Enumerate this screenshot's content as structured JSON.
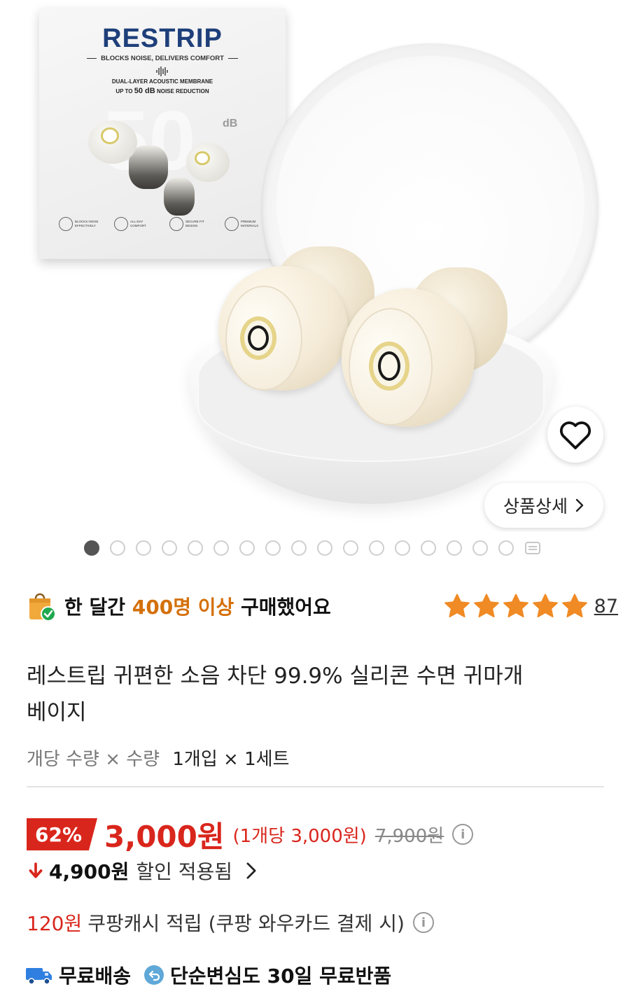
{
  "product_image": {
    "box_brand": "RESTRIP",
    "box_tagline": "BLOCKS NOISE, DELIVERS COMFORT",
    "box_spec_line1": "DUAL-LAYER ACOUSTIC MEMBRANE",
    "box_spec_line2_prefix": "UP TO",
    "box_spec_line2_value": "50 dB",
    "box_spec_line2_suffix": "NOISE REDUCTION",
    "box_big_number": "50",
    "box_db_label": "dB",
    "box_features": [
      {
        "label": "BLOCKS NOISE EFFECTIVELY",
        "icon": "sound-wave-icon"
      },
      {
        "label": "ALL-DAY COMFORT",
        "icon": "leaf-icon"
      },
      {
        "label": "SECURE FIT DESIGN",
        "icon": "ear-icon"
      },
      {
        "label": "PREMIUM MATERIALS",
        "icon": "shield-icon"
      }
    ],
    "wishlist_icon": "heart-icon",
    "detail_button_label": "상품상세",
    "carousel": {
      "total_dots": 17,
      "active_index": 0,
      "more_icon": "menu-lines-icon"
    }
  },
  "purchase_info": {
    "prefix": "한 달간",
    "highlight": "400명 이상",
    "suffix": "구매했어요",
    "rating": 5,
    "review_count": "87",
    "colors": {
      "highlight": "#d4700a",
      "star": "#f08a24"
    }
  },
  "product": {
    "title_line1": "레스트립 귀편한 소음 차단 99.9% 실리콘 수면 귀마개",
    "title_line2": "베이지",
    "option_label": "개당 수량 × 수량",
    "option_value": "1개입 × 1세트"
  },
  "pricing": {
    "discount_badge": "62%",
    "price": "3,000원",
    "unit_price": "(1개당 3,000원)",
    "original_price": "7,900원",
    "discount_amount": "4,900원",
    "discount_label": "할인 적용됨",
    "cashback_amount": "120원",
    "cashback_text": "쿠팡캐시 적립 (쿠팡 와우카드 결제 시)",
    "colors": {
      "accent": "#d9261c"
    }
  },
  "shipping": {
    "free_shipping": "무료배송",
    "return_text": "단순변심도 30일 무료반품"
  }
}
